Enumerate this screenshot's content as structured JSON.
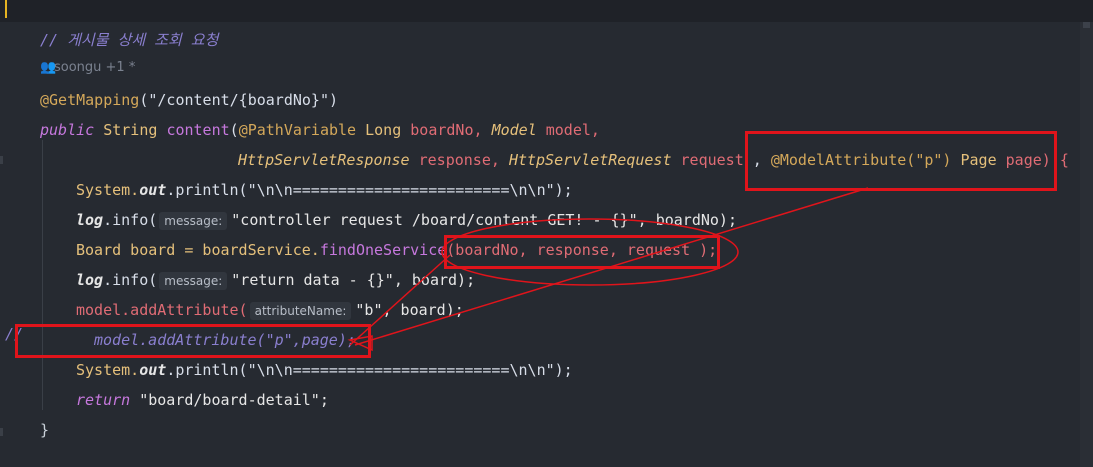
{
  "editor": {
    "comment": "// 게시물 상세 조회 요청",
    "author": "soongu +1 *",
    "lines": {
      "mapping": "@GetMapping",
      "mapping_arg": "(\"/content/{boardNo}\")",
      "sig1_public": "public",
      "sig1_string": "String",
      "sig1_name": "content",
      "sig1_ann": "@PathVariable",
      "sig1_long": "Long",
      "sig1_boardno": "boardNo,",
      "sig1_model_type": "Model",
      "sig1_model": "model,",
      "sig2_resp_type": "HttpServletResponse",
      "sig2_resp": "response,",
      "sig2_req_type": "HttpServletRequest",
      "sig2_req": "request",
      "sig2_comma": ",",
      "sig2_ann": "@ModelAttribute(\"p\")",
      "sig2_page_type": "Page",
      "sig2_page": "page) {",
      "sys1_a": "System.",
      "sys1_out": "out",
      "sys1_b": ".println(\"\\n\\n========================\\n\\n\");",
      "log1_a": "log",
      "log1_b": ".info(",
      "log1_hint": "message:",
      "log1_c": "\"controller request /board/content GET! - {}\", boardNo);",
      "board_a": "Board board = boardService.",
      "board_fn": "findOneService",
      "board_args": "(boardNo, response, request );",
      "log2_a": "log",
      "log2_b": ".info(",
      "log2_hint": "message:",
      "log2_c": "\"return data - {}\", board);",
      "model1_a": "model.addAttribute(",
      "model1_hint": "attributeName:",
      "model1_c": "\"b\", board);",
      "commented_slash": "//",
      "commented_model": "model.addAttribute(\"p\",page);",
      "sys2_a": "System.",
      "sys2_out": "out",
      "sys2_b": ".println(\"\\n\\n========================\\n\\n\");",
      "ret_kw": "return",
      "ret_val": "\"board/board-detail\";",
      "close": "}"
    }
  },
  "colors": {
    "background": "#262a31",
    "annotation_box": "#e0141b"
  }
}
